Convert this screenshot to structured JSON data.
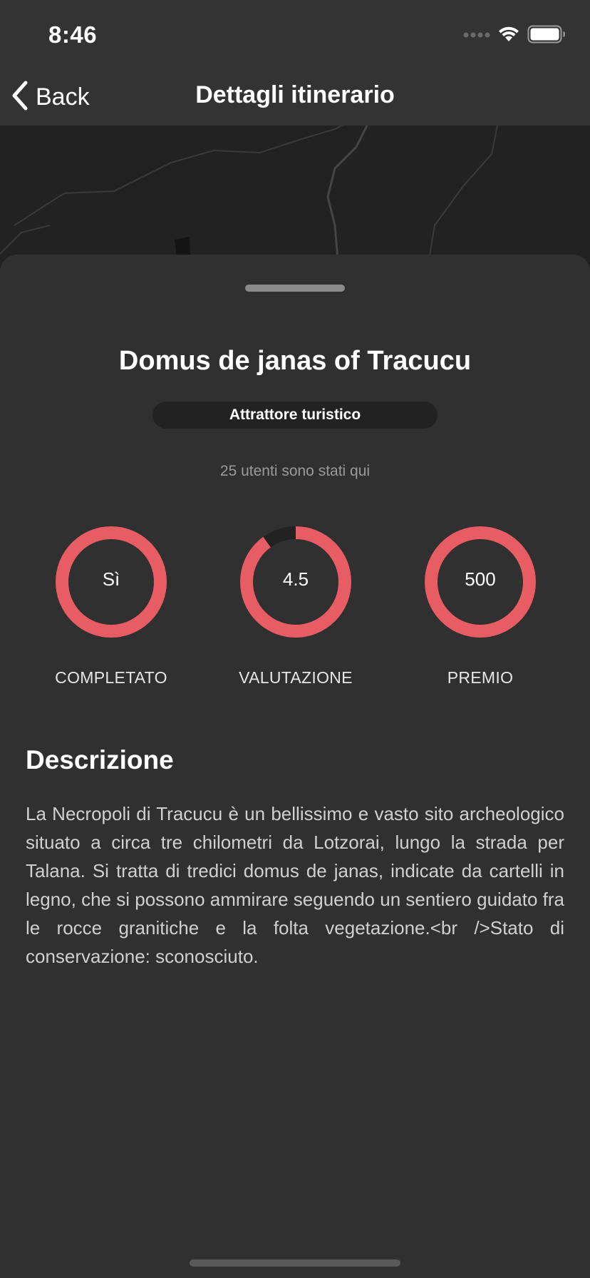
{
  "status_bar": {
    "time": "8:46",
    "icons": [
      "signal-icon",
      "wifi-icon",
      "battery-icon"
    ]
  },
  "nav": {
    "back_label": "Back",
    "title": "Dettagli itinerario"
  },
  "place": {
    "title": "Domus de janas of Tracucu",
    "category": "Attrattore turistico",
    "visitors_text": "25 utenti sono stati qui"
  },
  "stats": [
    {
      "value": "Sì",
      "label": "COMPLETATO",
      "progress": 1.0
    },
    {
      "value": "4.5",
      "label": "VALUTAZIONE",
      "progress": 0.9
    },
    {
      "value": "500",
      "label": "PREMIO",
      "progress": 1.0
    }
  ],
  "description": {
    "title": "Descrizione",
    "text": "La Necropoli di Tracucu è un bellissimo e vasto sito archeologico situato a circa tre chilometri da Lotzorai, lungo la strada per Talana. Si tratta di tredici domus de janas, indicate da cartelli in legno, che si possono ammirare seguendo un sentiero guidato fra le rocce granitiche e la folta vegetazione.<br />Stato di conservazione: sconosciuto."
  },
  "colors": {
    "accent": "#e85d64",
    "ring_track": "#222222",
    "background": "#303030",
    "bar": "#333333"
  }
}
